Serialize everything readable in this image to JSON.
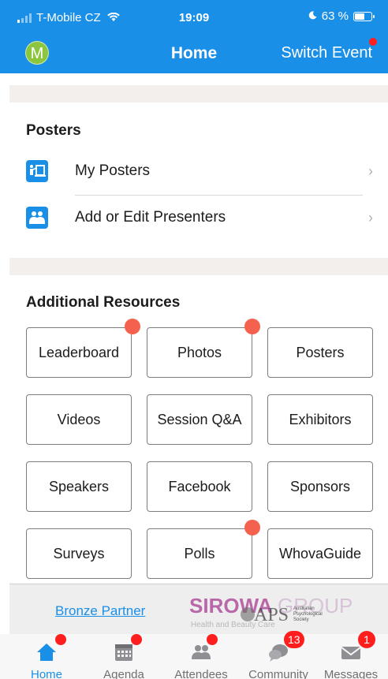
{
  "status_bar": {
    "carrier": "T-Mobile CZ",
    "time": "19:09",
    "battery": "63 %"
  },
  "nav": {
    "avatar_initial": "M",
    "title": "Home",
    "switch_event_label": "Switch Event"
  },
  "posters_section": {
    "title": "Posters",
    "items": [
      {
        "label": "My Posters",
        "icon": "poster-board-icon"
      },
      {
        "label": "Add or Edit Presenters",
        "icon": "presenters-icon"
      }
    ]
  },
  "resources_section": {
    "title": "Additional Resources",
    "tiles": [
      {
        "label": "Leaderboard",
        "badge": true
      },
      {
        "label": "Photos",
        "badge": true
      },
      {
        "label": "Posters",
        "badge": false
      },
      {
        "label": "Videos",
        "badge": false
      },
      {
        "label": "Session Q&A",
        "badge": false
      },
      {
        "label": "Exhibitors",
        "badge": false
      },
      {
        "label": "Speakers",
        "badge": false
      },
      {
        "label": "Facebook",
        "badge": false
      },
      {
        "label": "Sponsors",
        "badge": false
      },
      {
        "label": "Surveys",
        "badge": false
      },
      {
        "label": "Polls",
        "badge": true
      },
      {
        "label": "WhovaGuide",
        "badge": false
      }
    ]
  },
  "partner_banner": {
    "link_label": "Bronze Partner",
    "logo_text": "SIROWA GROUP",
    "logo_tagline": "Health and Beauty Care",
    "overlay_logo_text": "APS",
    "overlay_logo_subtext": "Australian Psychological Society"
  },
  "tab_bar": {
    "tabs": [
      {
        "label": "Home",
        "icon": "home-icon",
        "dot": true
      },
      {
        "label": "Agenda",
        "icon": "calendar-icon",
        "dot": true
      },
      {
        "label": "Attendees",
        "icon": "people-icon",
        "dot": true
      },
      {
        "label": "Community",
        "icon": "chat-bubbles-icon",
        "badge": "13"
      },
      {
        "label": "Messages",
        "icon": "envelope-icon",
        "badge": "1"
      }
    ]
  },
  "colors": {
    "brand_blue": "#1a8fe8",
    "badge_red": "#ff1e1e",
    "tile_dot": "#f4624f",
    "avatar_green": "#8cc63e"
  }
}
